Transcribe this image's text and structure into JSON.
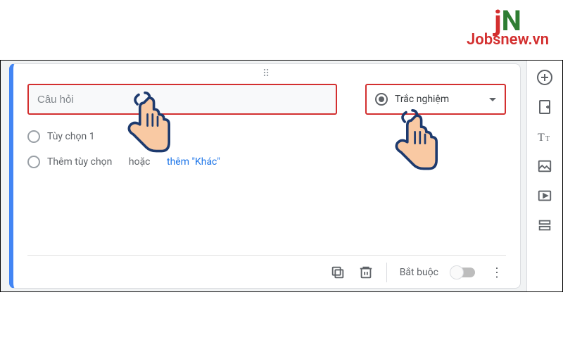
{
  "logo": {
    "text": "Jobsnew.vn"
  },
  "question": {
    "placeholder": "Câu hỏi",
    "type_label": "Trắc nghiệm"
  },
  "options": {
    "option1": "Tùy chọn 1",
    "add_option": "Thêm tùy chọn",
    "or": "hoặc",
    "add_other": "thêm \"Khác\""
  },
  "footer": {
    "required_label": "Bắt buộc"
  }
}
